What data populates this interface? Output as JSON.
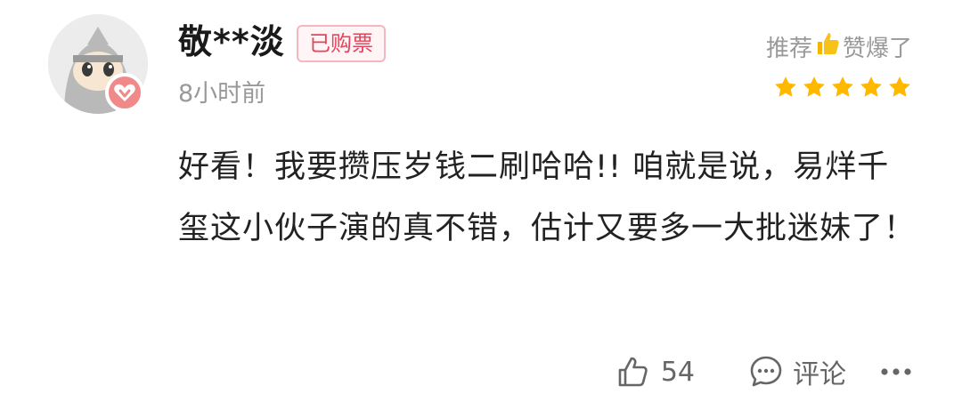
{
  "user": {
    "name": "敬**淡",
    "badge": "已购票",
    "time": "8小时前"
  },
  "rating": {
    "text_prefix": "推荐",
    "emoji": "👍",
    "text_suffix": "赞爆了",
    "stars": 5,
    "star_color": "#ffb800"
  },
  "comment": {
    "text": "好看！我要攒压岁钱二刷哈哈!! 咱就是说，易烊千玺这小伙子演的真不错，估计又要多一大批迷妹了！"
  },
  "actions": {
    "like_count": "54",
    "comment_label": "评论"
  },
  "colors": {
    "badge_text": "#e3455a",
    "badge_border": "#f3b7bf",
    "muted": "#999999"
  }
}
